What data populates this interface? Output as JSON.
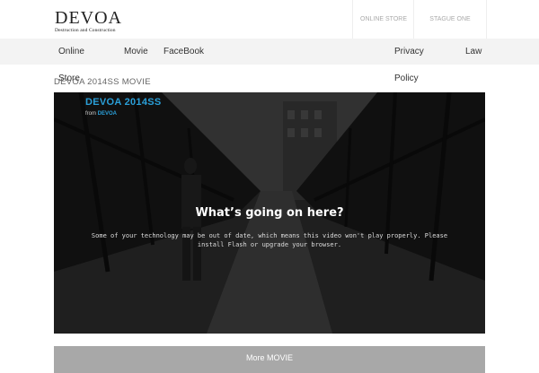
{
  "header": {
    "logo_main": "DEVOA",
    "logo_sub": "Destruction and Construction",
    "top_links": [
      "ONLINE STORE",
      "STAGUE ONE"
    ]
  },
  "nav": {
    "online": "Online",
    "store": "Store",
    "movie": "Movie",
    "facebook": "FaceBook",
    "privacy": "Privacy",
    "policy": "Policy",
    "law": "Law"
  },
  "section": {
    "title": "DEVOA 2014SS MOVIE"
  },
  "video": {
    "title": "DEVOA 2014SS",
    "from_label": "from",
    "author": "DEVOA",
    "heading": "What’s going on here?",
    "message": "Some of your technology may be out of date, which means this video won't play properly. Please install Flash or upgrade your browser."
  },
  "more_button": "More MOVIE",
  "colors": {
    "accent": "#2a9fd8",
    "nav_bg": "#f3f3f3",
    "button_bg": "#a8a8a8"
  }
}
